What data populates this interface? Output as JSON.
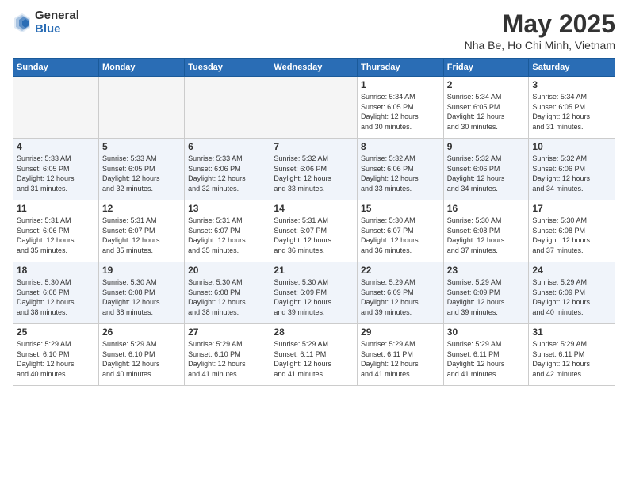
{
  "header": {
    "logo_general": "General",
    "logo_blue": "Blue",
    "month_year": "May 2025",
    "location": "Nha Be, Ho Chi Minh, Vietnam"
  },
  "days_of_week": [
    "Sunday",
    "Monday",
    "Tuesday",
    "Wednesday",
    "Thursday",
    "Friday",
    "Saturday"
  ],
  "weeks": [
    {
      "alt": false,
      "days": [
        {
          "num": "",
          "info": ""
        },
        {
          "num": "",
          "info": ""
        },
        {
          "num": "",
          "info": ""
        },
        {
          "num": "",
          "info": ""
        },
        {
          "num": "1",
          "info": "Sunrise: 5:34 AM\nSunset: 6:05 PM\nDaylight: 12 hours\nand 30 minutes."
        },
        {
          "num": "2",
          "info": "Sunrise: 5:34 AM\nSunset: 6:05 PM\nDaylight: 12 hours\nand 30 minutes."
        },
        {
          "num": "3",
          "info": "Sunrise: 5:34 AM\nSunset: 6:05 PM\nDaylight: 12 hours\nand 31 minutes."
        }
      ]
    },
    {
      "alt": true,
      "days": [
        {
          "num": "4",
          "info": "Sunrise: 5:33 AM\nSunset: 6:05 PM\nDaylight: 12 hours\nand 31 minutes."
        },
        {
          "num": "5",
          "info": "Sunrise: 5:33 AM\nSunset: 6:05 PM\nDaylight: 12 hours\nand 32 minutes."
        },
        {
          "num": "6",
          "info": "Sunrise: 5:33 AM\nSunset: 6:06 PM\nDaylight: 12 hours\nand 32 minutes."
        },
        {
          "num": "7",
          "info": "Sunrise: 5:32 AM\nSunset: 6:06 PM\nDaylight: 12 hours\nand 33 minutes."
        },
        {
          "num": "8",
          "info": "Sunrise: 5:32 AM\nSunset: 6:06 PM\nDaylight: 12 hours\nand 33 minutes."
        },
        {
          "num": "9",
          "info": "Sunrise: 5:32 AM\nSunset: 6:06 PM\nDaylight: 12 hours\nand 34 minutes."
        },
        {
          "num": "10",
          "info": "Sunrise: 5:32 AM\nSunset: 6:06 PM\nDaylight: 12 hours\nand 34 minutes."
        }
      ]
    },
    {
      "alt": false,
      "days": [
        {
          "num": "11",
          "info": "Sunrise: 5:31 AM\nSunset: 6:06 PM\nDaylight: 12 hours\nand 35 minutes."
        },
        {
          "num": "12",
          "info": "Sunrise: 5:31 AM\nSunset: 6:07 PM\nDaylight: 12 hours\nand 35 minutes."
        },
        {
          "num": "13",
          "info": "Sunrise: 5:31 AM\nSunset: 6:07 PM\nDaylight: 12 hours\nand 35 minutes."
        },
        {
          "num": "14",
          "info": "Sunrise: 5:31 AM\nSunset: 6:07 PM\nDaylight: 12 hours\nand 36 minutes."
        },
        {
          "num": "15",
          "info": "Sunrise: 5:30 AM\nSunset: 6:07 PM\nDaylight: 12 hours\nand 36 minutes."
        },
        {
          "num": "16",
          "info": "Sunrise: 5:30 AM\nSunset: 6:08 PM\nDaylight: 12 hours\nand 37 minutes."
        },
        {
          "num": "17",
          "info": "Sunrise: 5:30 AM\nSunset: 6:08 PM\nDaylight: 12 hours\nand 37 minutes."
        }
      ]
    },
    {
      "alt": true,
      "days": [
        {
          "num": "18",
          "info": "Sunrise: 5:30 AM\nSunset: 6:08 PM\nDaylight: 12 hours\nand 38 minutes."
        },
        {
          "num": "19",
          "info": "Sunrise: 5:30 AM\nSunset: 6:08 PM\nDaylight: 12 hours\nand 38 minutes."
        },
        {
          "num": "20",
          "info": "Sunrise: 5:30 AM\nSunset: 6:08 PM\nDaylight: 12 hours\nand 38 minutes."
        },
        {
          "num": "21",
          "info": "Sunrise: 5:30 AM\nSunset: 6:09 PM\nDaylight: 12 hours\nand 39 minutes."
        },
        {
          "num": "22",
          "info": "Sunrise: 5:29 AM\nSunset: 6:09 PM\nDaylight: 12 hours\nand 39 minutes."
        },
        {
          "num": "23",
          "info": "Sunrise: 5:29 AM\nSunset: 6:09 PM\nDaylight: 12 hours\nand 39 minutes."
        },
        {
          "num": "24",
          "info": "Sunrise: 5:29 AM\nSunset: 6:09 PM\nDaylight: 12 hours\nand 40 minutes."
        }
      ]
    },
    {
      "alt": false,
      "days": [
        {
          "num": "25",
          "info": "Sunrise: 5:29 AM\nSunset: 6:10 PM\nDaylight: 12 hours\nand 40 minutes."
        },
        {
          "num": "26",
          "info": "Sunrise: 5:29 AM\nSunset: 6:10 PM\nDaylight: 12 hours\nand 40 minutes."
        },
        {
          "num": "27",
          "info": "Sunrise: 5:29 AM\nSunset: 6:10 PM\nDaylight: 12 hours\nand 41 minutes."
        },
        {
          "num": "28",
          "info": "Sunrise: 5:29 AM\nSunset: 6:11 PM\nDaylight: 12 hours\nand 41 minutes."
        },
        {
          "num": "29",
          "info": "Sunrise: 5:29 AM\nSunset: 6:11 PM\nDaylight: 12 hours\nand 41 minutes."
        },
        {
          "num": "30",
          "info": "Sunrise: 5:29 AM\nSunset: 6:11 PM\nDaylight: 12 hours\nand 41 minutes."
        },
        {
          "num": "31",
          "info": "Sunrise: 5:29 AM\nSunset: 6:11 PM\nDaylight: 12 hours\nand 42 minutes."
        }
      ]
    }
  ]
}
